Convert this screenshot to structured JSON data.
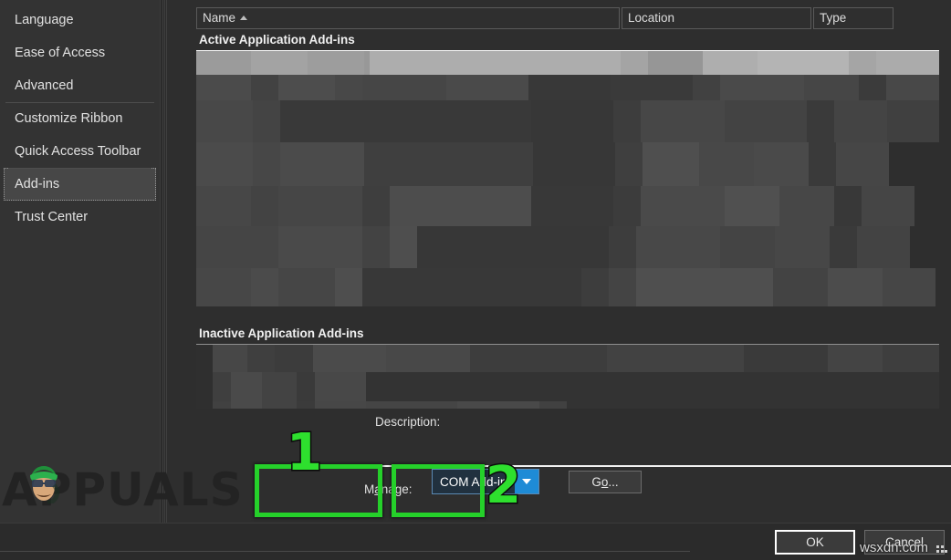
{
  "sidebar": {
    "items": [
      {
        "label": "Language",
        "selected": false,
        "separator_above": false
      },
      {
        "label": "Ease of Access",
        "selected": false,
        "separator_above": false
      },
      {
        "label": "Advanced",
        "selected": false,
        "separator_above": false
      },
      {
        "label": "Customize Ribbon",
        "selected": false,
        "separator_above": true
      },
      {
        "label": "Quick Access Toolbar",
        "selected": false,
        "separator_above": false
      },
      {
        "label": "Add-ins",
        "selected": true,
        "separator_above": true
      },
      {
        "label": "Trust Center",
        "selected": false,
        "separator_above": false
      }
    ]
  },
  "list": {
    "columns": [
      {
        "label": "Name",
        "sorted": true,
        "sort_direction": "ascending"
      },
      {
        "label": "Location",
        "sorted": false,
        "sort_direction": ""
      },
      {
        "label": "Type",
        "sorted": false,
        "sort_direction": ""
      }
    ],
    "groups": [
      {
        "label": "Active Application Add-ins"
      },
      {
        "label": "Inactive Application Add-ins"
      }
    ],
    "rows_redacted": true,
    "selected_row_present": true
  },
  "scrollbar": {
    "up_icon": "triangle-up-icon",
    "down_icon": "triangle-down-icon",
    "thumb_position": "near-top"
  },
  "description": {
    "label": "Description:",
    "value": ""
  },
  "manage": {
    "label_prefix": "M",
    "label_accel": "a",
    "label_suffix": "nage:",
    "selected_option": "COM Add-ins",
    "options": [
      "COM Add-ins"
    ],
    "dropdown_icon": "chevron-down-icon",
    "go_prefix": "G",
    "go_accel": "o",
    "go_suffix": "..."
  },
  "annotations": [
    {
      "number": "1",
      "target": "manage-combobox"
    },
    {
      "number": "2",
      "target": "go-button"
    }
  ],
  "buttons": {
    "ok": "OK",
    "cancel": "Cancel"
  },
  "watermarks": {
    "brand": "APPUALS",
    "site": "wsxdn.com"
  },
  "colors": {
    "background": "#2b2b2b",
    "sidebar": "#333333",
    "content": "#2e2e2e",
    "accent_green": "#25d02a",
    "accent_blue": "#1e8bd6",
    "combo_body": "#21313f",
    "selected_row": "#a6a6a6",
    "text": "#e2e2e2",
    "rule_white": "#f2f2f2"
  }
}
